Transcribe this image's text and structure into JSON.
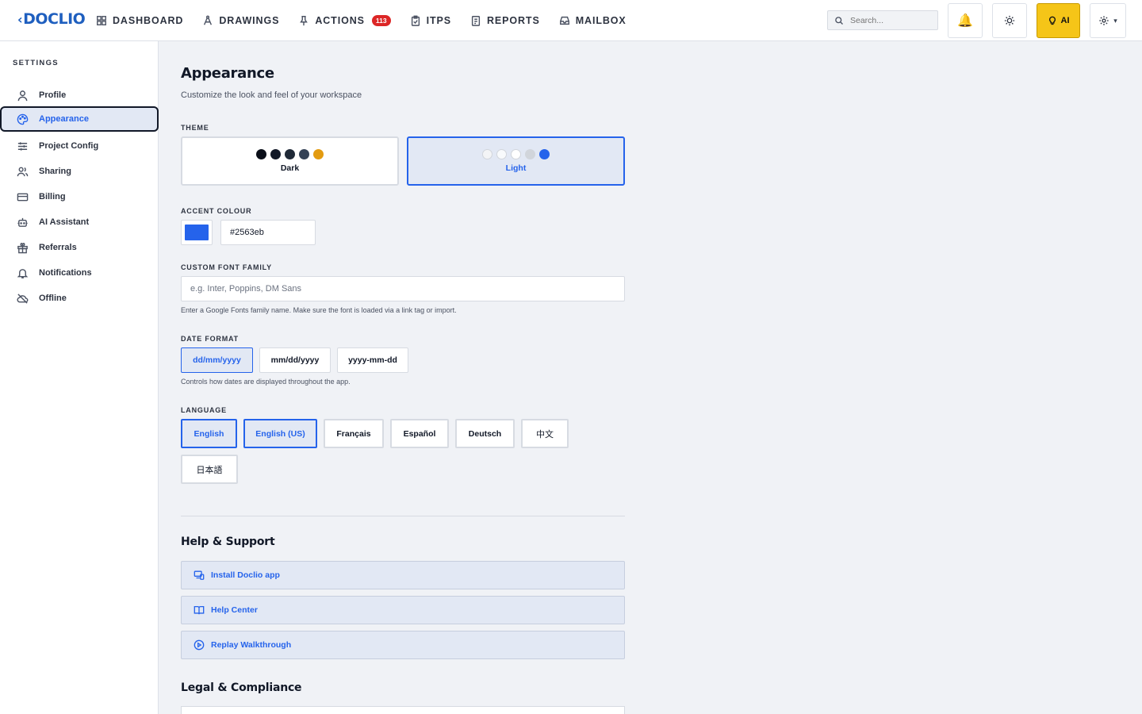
{
  "header": {
    "logo": "DOCLIO",
    "nav": [
      {
        "label": "DASHBOARD",
        "icon": "grid-icon"
      },
      {
        "label": "DRAWINGS",
        "icon": "compass-icon"
      },
      {
        "label": "ACTIONS",
        "icon": "pin-icon",
        "badge": "113"
      },
      {
        "label": "ITPS",
        "icon": "clipboard-check-icon"
      },
      {
        "label": "REPORTS",
        "icon": "report-icon"
      },
      {
        "label": "MAILBOX",
        "icon": "inbox-icon"
      }
    ],
    "search_placeholder": "Search...",
    "ai_label": "AI",
    "gear_caret": "▾"
  },
  "sidebar": {
    "heading": "SETTINGS",
    "items": [
      {
        "label": "Profile",
        "icon": "user-icon"
      },
      {
        "label": "Appearance",
        "icon": "palette-icon",
        "active": true
      },
      {
        "label": "Project Config",
        "icon": "sliders-icon"
      },
      {
        "label": "Sharing",
        "icon": "users-icon"
      },
      {
        "label": "Billing",
        "icon": "credit-card-icon"
      },
      {
        "label": "AI Assistant",
        "icon": "bot-icon"
      },
      {
        "label": "Referrals",
        "icon": "gift-icon"
      },
      {
        "label": "Notifications",
        "icon": "bell-icon"
      },
      {
        "label": "Offline",
        "icon": "cloud-off-icon"
      }
    ]
  },
  "appearance": {
    "title": "Appearance",
    "subtitle": "Customize the look and feel of your workspace",
    "theme_label": "THEME",
    "themes": [
      {
        "name": "Dark",
        "dots": [
          "#0b0f19",
          "#111827",
          "#1f2937",
          "#334155",
          "#e39b10"
        ],
        "selected": false
      },
      {
        "name": "Light",
        "dots": [
          "#f3f4f6",
          "#f8fafc",
          "#ffffff",
          "#d1d5db",
          "#2563eb"
        ],
        "selected": true
      }
    ],
    "accent_label": "ACCENT COLOUR",
    "accent_value": "#2563eb",
    "font_label": "CUSTOM FONT FAMILY",
    "font_placeholder": "e.g. Inter, Poppins, DM Sans",
    "font_hint": "Enter a Google Fonts family name. Make sure the font is loaded via a link tag or import.",
    "date_label": "DATE FORMAT",
    "date_formats": [
      {
        "label": "dd/mm/yyyy",
        "selected": true
      },
      {
        "label": "mm/dd/yyyy",
        "selected": false
      },
      {
        "label": "yyyy-mm-dd",
        "selected": false
      }
    ],
    "date_hint": "Controls how dates are displayed throughout the app.",
    "language_label": "LANGUAGE",
    "languages": [
      {
        "label": "English",
        "selected": true
      },
      {
        "label": "English (US)",
        "selected": true
      },
      {
        "label": "Français",
        "selected": false
      },
      {
        "label": "Español",
        "selected": false
      },
      {
        "label": "Deutsch",
        "selected": false
      },
      {
        "label": "中文",
        "selected": false
      },
      {
        "label": "日本語",
        "selected": false
      }
    ]
  },
  "help": {
    "title": "Help & Support",
    "items": [
      {
        "label": "Install Doclio app",
        "icon": "devices-icon"
      },
      {
        "label": "Help Center",
        "icon": "book-icon"
      },
      {
        "label": "Replay Walkthrough",
        "icon": "play-circle-icon"
      }
    ]
  },
  "legal": {
    "title": "Legal & Compliance"
  },
  "colors": {
    "accent": "#2563eb",
    "ai_button": "#f5c518",
    "badge": "#dc2626"
  }
}
